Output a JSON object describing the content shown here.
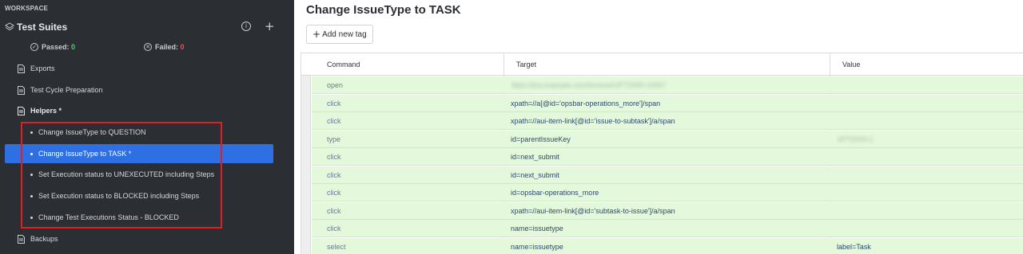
{
  "sidebar": {
    "workspace_label": "WORKSPACE",
    "suites_title": "Test Suites",
    "passed_label": "Passed:",
    "passed_value": "0",
    "failed_label": "Failed:",
    "failed_value": "0",
    "items": {
      "exports": "Exports",
      "prep": "Test Cycle Preparation",
      "helpers": "Helpers *",
      "backups": "Backups"
    },
    "helpers_children": [
      "Change IssueType to QUESTION",
      "Change IssueType to TASK *",
      "Set Execution status to UNEXECUTED including Steps",
      "Set Execution status to BLOCKED including Steps",
      "Change Test Executions Status - BLOCKED"
    ]
  },
  "main": {
    "title": "Change IssueType to TASK",
    "add_tag_label": "Add new tag",
    "columns": {
      "command": "Command",
      "target": "Target",
      "value": "Value"
    },
    "rows": [
      {
        "command": "open",
        "target": "https://jira.example.com/browse/UFT2000-10067",
        "value": ""
      },
      {
        "command": "click",
        "target": "xpath=//a[@id='opsbar-operations_more']/span",
        "value": ""
      },
      {
        "command": "click",
        "target": "xpath=//aui-item-link[@id='issue-to-subtask']/a/span",
        "value": ""
      },
      {
        "command": "type",
        "target": "id=parentIssueKey",
        "value": "UFT2000-1"
      },
      {
        "command": "click",
        "target": "id=next_submit",
        "value": ""
      },
      {
        "command": "click",
        "target": "id=next_submit",
        "value": ""
      },
      {
        "command": "click",
        "target": "id=opsbar-operations_more",
        "value": ""
      },
      {
        "command": "click",
        "target": "xpath=//aui-item-link[@id='subtask-to-issue']/a/span",
        "value": ""
      },
      {
        "command": "click",
        "target": "name=issuetype",
        "value": ""
      },
      {
        "command": "select",
        "target": "name=issuetype",
        "value": "label=Task"
      }
    ]
  },
  "colors": {
    "sidebar_bg": "#2b2e33",
    "active_item": "#2f6fe4",
    "row_bg": "#e4f9dc",
    "highlight_box": "#e01e23",
    "passed": "#5ec27a",
    "failed": "#e5554f"
  },
  "icons": {
    "suites": "layers-icon",
    "info": "info-icon",
    "add": "plus-icon",
    "passed": "check-circle-icon",
    "failed": "x-circle-icon",
    "page": "document-icon"
  }
}
